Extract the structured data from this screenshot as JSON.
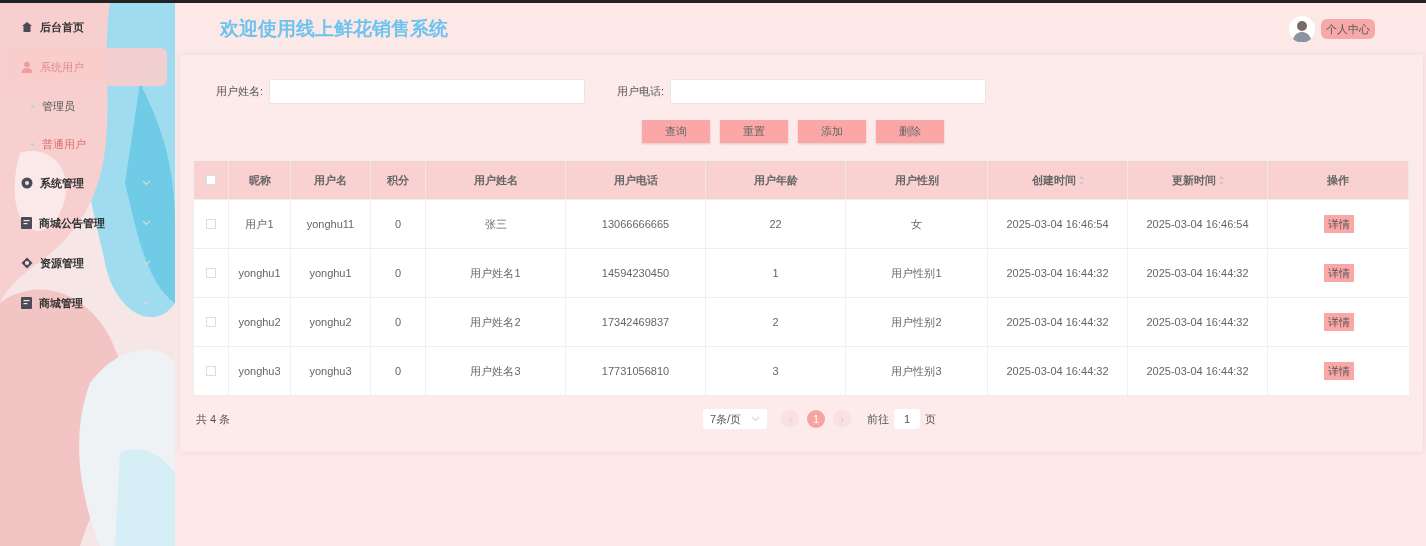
{
  "sidebar": {
    "items": [
      {
        "label": "后台首页",
        "selected": false
      },
      {
        "label": "系统用户",
        "expanded": true,
        "selected": true,
        "children": [
          {
            "label": "管理员",
            "selected": false
          },
          {
            "label": "普通用户",
            "selected": true
          }
        ]
      },
      {
        "label": "系统管理",
        "expanded": false,
        "selected": false
      },
      {
        "label": "商城公告管理",
        "expanded": false,
        "selected": false
      },
      {
        "label": "资源管理",
        "expanded": false,
        "selected": false
      },
      {
        "label": "商城管理",
        "expanded": false,
        "selected": false
      }
    ]
  },
  "header": {
    "title": "欢迎使用线上鲜花销售系统",
    "profile_button": "个人中心"
  },
  "search": {
    "fields": [
      {
        "label": "用户姓名:"
      },
      {
        "label": "用户电话:"
      }
    ],
    "buttons": [
      "查询",
      "重置",
      "添加",
      "删除"
    ]
  },
  "table": {
    "header_checked": false,
    "columns": [
      {
        "label": "昵称",
        "sortable": false
      },
      {
        "label": "用户名",
        "sortable": false
      },
      {
        "label": "积分",
        "sortable": false
      },
      {
        "label": "用户姓名",
        "sortable": false
      },
      {
        "label": "用户电话",
        "sortable": false
      },
      {
        "label": "用户年龄",
        "sortable": false
      },
      {
        "label": "用户性别",
        "sortable": false
      },
      {
        "label": "创建时间",
        "sortable": true
      },
      {
        "label": "更新时间",
        "sortable": true
      },
      {
        "label": "操作",
        "sortable": false
      }
    ],
    "rows": [
      {
        "checked": false,
        "cells": [
          "用户1",
          "yonghu11",
          "0",
          "张三",
          "13066666665",
          "22",
          "女",
          "2025-03-04 16:46:54",
          "2025-03-04 16:46:54"
        ],
        "action": "详情"
      },
      {
        "checked": false,
        "cells": [
          "yonghu1",
          "yonghu1",
          "0",
          "用户姓名1",
          "14594230450",
          "1",
          "用户性别1",
          "2025-03-04 16:44:32",
          "2025-03-04 16:44:32"
        ],
        "action": "详情"
      },
      {
        "checked": false,
        "cells": [
          "yonghu2",
          "yonghu2",
          "0",
          "用户姓名2",
          "17342469837",
          "2",
          "用户性别2",
          "2025-03-04 16:44:32",
          "2025-03-04 16:44:32"
        ],
        "action": "详情"
      },
      {
        "checked": false,
        "cells": [
          "yonghu3",
          "yonghu3",
          "0",
          "用户姓名3",
          "17731056810",
          "3",
          "用户性别3",
          "2025-03-04 16:44:32",
          "2025-03-04 16:44:32"
        ],
        "action": "详情"
      }
    ]
  },
  "pagination": {
    "total": "共 4 条",
    "page_size": "7条/页",
    "pages": [
      {
        "label": "1",
        "selected": true
      }
    ],
    "goto_label": "前往",
    "goto_value": "1",
    "goto_suffix": "页"
  }
}
